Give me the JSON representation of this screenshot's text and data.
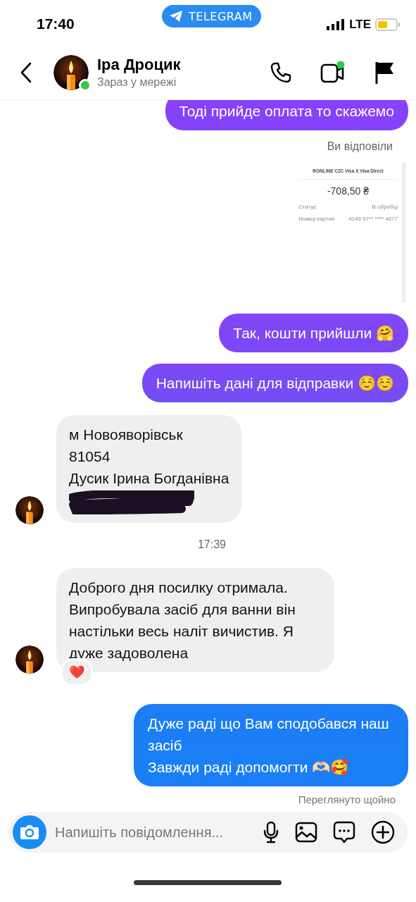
{
  "status_bar": {
    "time": "17:40",
    "back_app": "TELEGRAM",
    "network": "LTE"
  },
  "header": {
    "name": "Іра Дроцик",
    "status": "Зараз у мережі",
    "online": true
  },
  "messages": [
    {
      "kind": "outgoing",
      "text": "Тоді прийде оплата то скажемо"
    },
    {
      "kind": "label",
      "text": "Ви відповіли"
    },
    {
      "receipt": {
        "title": "RONLINE C2C Visa X Visa Direct",
        "amount": "-708,50 ₴",
        "rows": [
          {
            "label": "Статус",
            "value": "В обробці"
          },
          {
            "label": "Номер картки",
            "value": "4149 57** **** 4677"
          }
        ]
      }
    },
    {
      "kind": "outgoing",
      "text": "Так, кошти прийшли 🤗"
    },
    {
      "kind": "outgoing",
      "text": "Напишіть дані для відправки ☺️☺️"
    },
    {
      "kind": "incoming",
      "text": "м Новояворівськ\n81054\nДусик Ірина Богданівна",
      "avatar": true,
      "redacted": true
    },
    {
      "kind": "time",
      "text": "17:39"
    },
    {
      "kind": "incoming",
      "text": "Доброго дня посилку отримала. Випробувала засіб для ванни він настільки весь наліт вичистив. Я дуже задоволена",
      "avatar": true,
      "reaction": "❤️"
    },
    {
      "kind": "outgoing",
      "text": "Дуже раді що Вам сподобався наш засіб\nЗавжди раді допомогти 🫶🏻🥰"
    },
    {
      "kind": "seen",
      "text": "Переглянуто щойно"
    }
  ],
  "composer": {
    "placeholder": "Напишіть повідомлення..."
  }
}
